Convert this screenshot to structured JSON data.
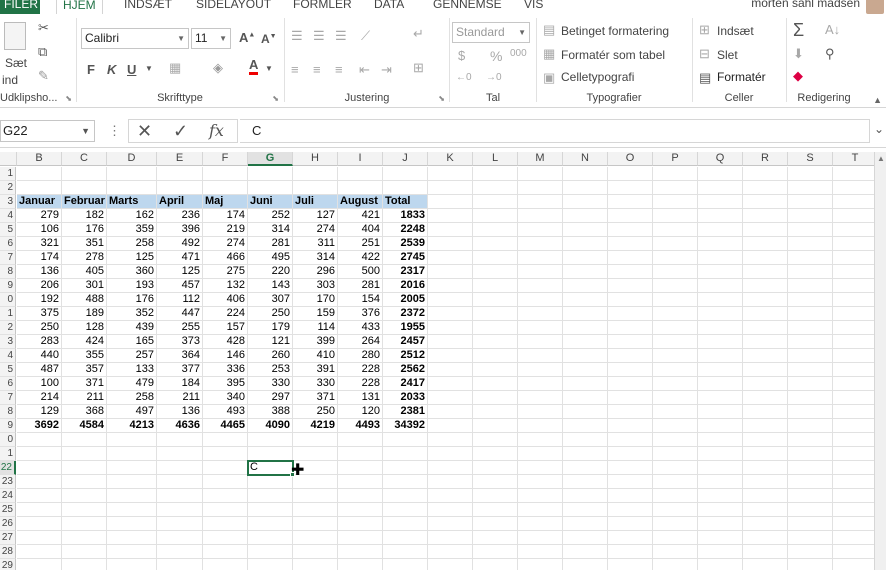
{
  "tabs": {
    "file": "FILER",
    "items": [
      {
        "label": "HJEM",
        "active": true
      },
      {
        "label": "INDSÆT"
      },
      {
        "label": "SIDELAYOUT"
      },
      {
        "label": "FORMLER"
      },
      {
        "label": "DATA"
      },
      {
        "label": "GENNEMSE"
      },
      {
        "label": "VIS"
      }
    ],
    "user": "morten sahl madsen"
  },
  "ribbon": {
    "clipboard": {
      "paste": "Sæt",
      "paste2": "ind",
      "label": "Udklipsho..."
    },
    "font": {
      "name": "Calibri",
      "size": "11",
      "bold": "F",
      "italic": "K",
      "underline": "U",
      "label": "Skrifttype"
    },
    "alignment": {
      "label": "Justering"
    },
    "number": {
      "format": "Standard",
      "percent": "%",
      "thousands": "000",
      "label": "Tal"
    },
    "styles": {
      "conditional": "Betinget formatering",
      "table": "Formatér som tabel",
      "cell": "Celletypografi",
      "label": "Typografier"
    },
    "cells": {
      "insert": "Indsæt",
      "delete": "Slet",
      "format": "Formatér",
      "label": "Celler"
    },
    "editing": {
      "label": "Redigering"
    }
  },
  "formula_bar": {
    "name_box": "G22",
    "dots": "⋮",
    "cancel": "✕",
    "enter": "✓",
    "fx": "fx",
    "content": "C"
  },
  "sheet": {
    "columns": [
      "B",
      "C",
      "D",
      "E",
      "F",
      "G",
      "H",
      "I",
      "J",
      "K",
      "L",
      "M",
      "N",
      "O",
      "P",
      "Q",
      "R",
      "S",
      "T"
    ],
    "selected_column": "G",
    "row_labels": [
      "1",
      "2",
      "3",
      "4",
      "5",
      "6",
      "7",
      "8",
      "9",
      "0",
      "1",
      "2",
      "3",
      "4",
      "5",
      "6",
      "7",
      "8",
      "9",
      "0",
      "1",
      "22",
      "23",
      "24",
      "25",
      "26",
      "27",
      "28",
      "29"
    ],
    "selected_row": "22",
    "header_row": [
      "Januar",
      "Februar",
      "Marts",
      "April",
      "Maj",
      "Juni",
      "Juli",
      "August",
      "Total"
    ],
    "data_rows": [
      [
        "279",
        "182",
        "162",
        "236",
        "174",
        "252",
        "127",
        "421",
        "1833"
      ],
      [
        "106",
        "176",
        "359",
        "396",
        "219",
        "314",
        "274",
        "404",
        "2248"
      ],
      [
        "321",
        "351",
        "258",
        "492",
        "274",
        "281",
        "311",
        "251",
        "2539"
      ],
      [
        "174",
        "278",
        "125",
        "471",
        "466",
        "495",
        "314",
        "422",
        "2745"
      ],
      [
        "136",
        "405",
        "360",
        "125",
        "275",
        "220",
        "296",
        "500",
        "2317"
      ],
      [
        "206",
        "301",
        "193",
        "457",
        "132",
        "143",
        "303",
        "281",
        "2016"
      ],
      [
        "192",
        "488",
        "176",
        "112",
        "406",
        "307",
        "170",
        "154",
        "2005"
      ],
      [
        "375",
        "189",
        "352",
        "447",
        "224",
        "250",
        "159",
        "376",
        "2372"
      ],
      [
        "250",
        "128",
        "439",
        "255",
        "157",
        "179",
        "114",
        "433",
        "1955"
      ],
      [
        "283",
        "424",
        "165",
        "373",
        "428",
        "121",
        "399",
        "264",
        "2457"
      ],
      [
        "440",
        "355",
        "257",
        "364",
        "146",
        "260",
        "410",
        "280",
        "2512"
      ],
      [
        "487",
        "357",
        "133",
        "377",
        "336",
        "253",
        "391",
        "228",
        "2562"
      ],
      [
        "100",
        "371",
        "479",
        "184",
        "395",
        "330",
        "330",
        "228",
        "2417"
      ],
      [
        "214",
        "211",
        "258",
        "211",
        "340",
        "297",
        "371",
        "131",
        "2033"
      ],
      [
        "129",
        "368",
        "497",
        "136",
        "493",
        "388",
        "250",
        "120",
        "2381"
      ]
    ],
    "totals_row": [
      "3692",
      "4584",
      "4213",
      "4636",
      "4465",
      "4090",
      "4219",
      "4493",
      "34392"
    ],
    "active_cell_value": "C",
    "header_fill": "#bdd7ee",
    "accent": "#217346"
  }
}
